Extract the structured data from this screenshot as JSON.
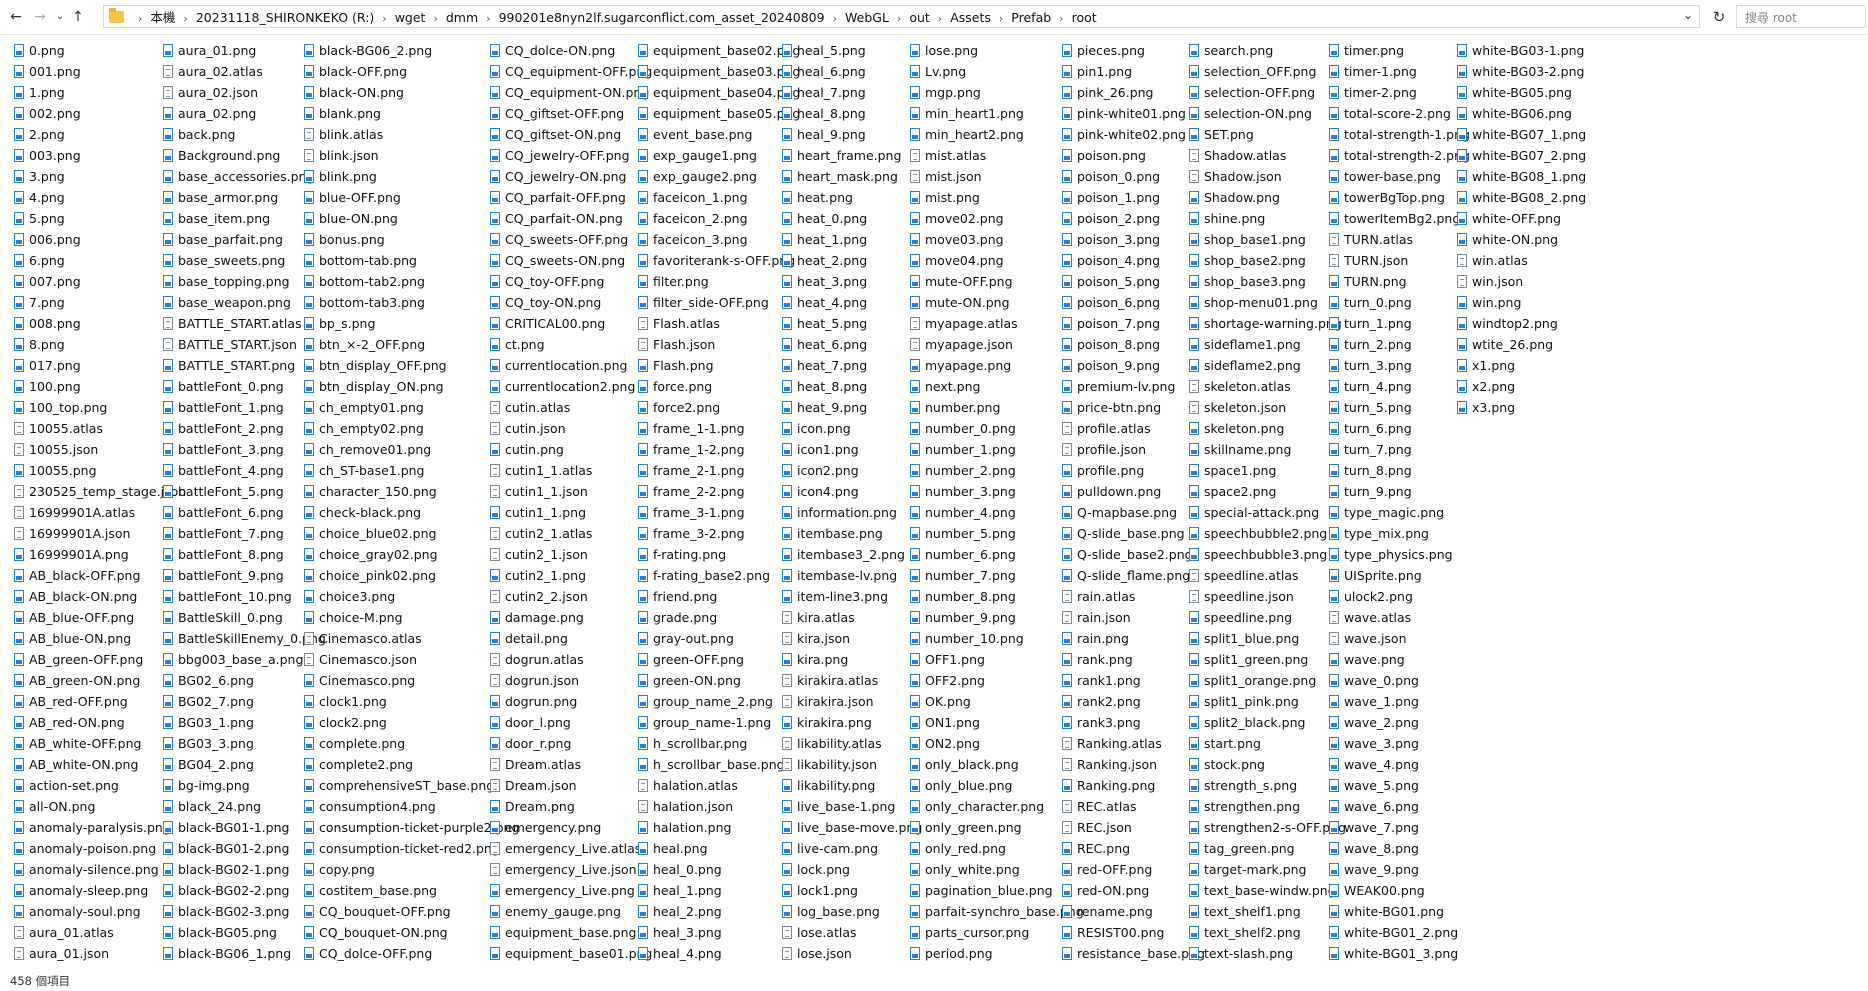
{
  "nav": {
    "back_icon": "arrow-left-icon",
    "forward_icon": "arrow-right-icon",
    "recent_icon": "chevron-down-icon",
    "up_icon": "arrow-up-icon"
  },
  "address": {
    "crumbs": [
      "本機",
      "20231118_SHIRONKEKO (R:)",
      "wget",
      "dmm",
      "990201e8nyn2lf.sugarconflict.com_asset_20240809",
      "WebGL",
      "out",
      "Assets",
      "Prefab",
      "root"
    ]
  },
  "search": {
    "placeholder": "搜尋 root"
  },
  "status": {
    "item_count": "458 個項目"
  },
  "files": [
    [
      "0.png",
      "001.png",
      "1.png",
      "002.png",
      "2.png",
      "003.png",
      "3.png",
      "4.png",
      "5.png",
      "006.png",
      "6.png",
      "007.png",
      "7.png",
      "008.png",
      "8.png",
      "017.png",
      "100.png",
      "100_top.png",
      "10055.atlas",
      "10055.json",
      "10055.png",
      "230525_temp_stage.json",
      "16999901A.atlas",
      "16999901A.json",
      "16999901A.png",
      "AB_black-OFF.png",
      "AB_black-ON.png",
      "AB_blue-OFF.png",
      "AB_blue-ON.png",
      "AB_green-OFF.png",
      "AB_green-ON.png",
      "AB_red-OFF.png",
      "AB_red-ON.png",
      "AB_white-OFF.png",
      "AB_white-ON.png",
      "action-set.png",
      "all-ON.png",
      "anomaly-paralysis.png",
      "anomaly-poison.png",
      "anomaly-silence.png",
      "anomaly-sleep.png",
      "anomaly-soul.png",
      "aura_01.atlas",
      "aura_01.json"
    ],
    [
      "aura_01.png",
      "aura_02.atlas",
      "aura_02.json",
      "aura_02.png",
      "back.png",
      "Background.png",
      "base_accessories.png",
      "base_armor.png",
      "base_item.png",
      "base_parfait.png",
      "base_sweets.png",
      "base_topping.png",
      "base_weapon.png",
      "BATTLE_START.atlas",
      "BATTLE_START.json",
      "BATTLE_START.png",
      "battleFont_0.png",
      "battleFont_1.png",
      "battleFont_2.png",
      "battleFont_3.png",
      "battleFont_4.png",
      "battleFont_5.png",
      "battleFont_6.png",
      "battleFont_7.png",
      "battleFont_8.png",
      "battleFont_9.png",
      "battleFont_10.png",
      "BattleSkill_0.png",
      "BattleSkillEnemy_0.png",
      "bbg003_base_a.png",
      "BG02_6.png",
      "BG02_7.png",
      "BG03_1.png",
      "BG03_3.png",
      "BG04_2.png",
      "bg-img.png",
      "black_24.png",
      "black-BG01-1.png",
      "black-BG01-2.png",
      "black-BG02-1.png",
      "black-BG02-2.png",
      "black-BG02-3.png",
      "black-BG05.png",
      "black-BG06_1.png"
    ],
    [
      "black-BG06_2.png",
      "black-OFF.png",
      "black-ON.png",
      "blank.png",
      "blink.atlas",
      "blink.json",
      "blink.png",
      "blue-OFF.png",
      "blue-ON.png",
      "bonus.png",
      "bottom-tab.png",
      "bottom-tab2.png",
      "bottom-tab3.png",
      "bp_s.png",
      "btn_×-2_OFF.png",
      "btn_display_OFF.png",
      "btn_display_ON.png",
      "ch_empty01.png",
      "ch_empty02.png",
      "ch_remove01.png",
      "ch_ST-base1.png",
      "character_150.png",
      "check-black.png",
      "choice_blue02.png",
      "choice_gray02.png",
      "choice_pink02.png",
      "choice3.png",
      "choice-M.png",
      "Cinemasco.atlas",
      "Cinemasco.json",
      "Cinemasco.png",
      "clock1.png",
      "clock2.png",
      "complete.png",
      "complete2.png",
      "comprehensiveST_base.png",
      "consumption4.png",
      "consumption-ticket-purple2.png",
      "consumption-ticket-red2.png",
      "copy.png",
      "costitem_base.png",
      "CQ_bouquet-OFF.png",
      "CQ_bouquet-ON.png",
      "CQ_dolce-OFF.png"
    ],
    [
      "CQ_dolce-ON.png",
      "CQ_equipment-OFF.png",
      "CQ_equipment-ON.png",
      "CQ_giftset-OFF.png",
      "CQ_giftset-ON.png",
      "CQ_jewelry-OFF.png",
      "CQ_jewelry-ON.png",
      "CQ_parfait-OFF.png",
      "CQ_parfait-ON.png",
      "CQ_sweets-OFF.png",
      "CQ_sweets-ON.png",
      "CQ_toy-OFF.png",
      "CQ_toy-ON.png",
      "CRITICAL00.png",
      "ct.png",
      "currentlocation.png",
      "currentlocation2.png",
      "cutin.atlas",
      "cutin.json",
      "cutin.png",
      "cutin1_1.atlas",
      "cutin1_1.json",
      "cutin1_1.png",
      "cutin2_1.atlas",
      "cutin2_1.json",
      "cutin2_1.png",
      "cutin2_2.json",
      "damage.png",
      "detail.png",
      "dogrun.atlas",
      "dogrun.json",
      "dogrun.png",
      "door_l.png",
      "door_r.png",
      "Dream.atlas",
      "Dream.json",
      "Dream.png",
      "emergency.png",
      "emergency_Live.atlas",
      "emergency_Live.json",
      "emergency_Live.png",
      "enemy_gauge.png",
      "equipment_base.png",
      "equipment_base01.png"
    ],
    [
      "equipment_base02.png",
      "equipment_base03.png",
      "equipment_base04.png",
      "equipment_base05.png",
      "event_base.png",
      "exp_gauge1.png",
      "exp_gauge2.png",
      "faceicon_1.png",
      "faceicon_2.png",
      "faceicon_3.png",
      "favoriterank-s-OFF.png",
      "filter.png",
      "filter_side-OFF.png",
      "Flash.atlas",
      "Flash.json",
      "Flash.png",
      "force.png",
      "force2.png",
      "frame_1-1.png",
      "frame_1-2.png",
      "frame_2-1.png",
      "frame_2-2.png",
      "frame_3-1.png",
      "frame_3-2.png",
      "f-rating.png",
      "f-rating_base2.png",
      "friend.png",
      "grade.png",
      "gray-out.png",
      "green-OFF.png",
      "green-ON.png",
      "group_name_2.png",
      "group_name-1.png",
      "h_scrollbar.png",
      "h_scrollbar_base.png",
      "halation.atlas",
      "halation.json",
      "halation.png",
      "heal.png",
      "heal_0.png",
      "heal_1.png",
      "heal_2.png",
      "heal_3.png",
      "heal_4.png"
    ],
    [
      "heal_5.png",
      "heal_6.png",
      "heal_7.png",
      "heal_8.png",
      "heal_9.png",
      "heart_frame.png",
      "heart_mask.png",
      "heat.png",
      "heat_0.png",
      "heat_1.png",
      "heat_2.png",
      "heat_3.png",
      "heat_4.png",
      "heat_5.png",
      "heat_6.png",
      "heat_7.png",
      "heat_8.png",
      "heat_9.png",
      "icon.png",
      "icon1.png",
      "icon2.png",
      "icon4.png",
      "information.png",
      "itembase.png",
      "itembase3_2.png",
      "itembase-lv.png",
      "item-line3.png",
      "kira.atlas",
      "kira.json",
      "kira.png",
      "kirakira.atlas",
      "kirakira.json",
      "kirakira.png",
      "likability.atlas",
      "likability.json",
      "likability.png",
      "live_base-1.png",
      "live_base-move.png",
      "live-cam.png",
      "lock.png",
      "lock1.png",
      "log_base.png",
      "lose.atlas",
      "lose.json"
    ],
    [
      "lose.png",
      "Lv.png",
      "mgp.png",
      "min_heart1.png",
      "min_heart2.png",
      "mist.atlas",
      "mist.json",
      "mist.png",
      "move02.png",
      "move03.png",
      "move04.png",
      "mute-OFF.png",
      "mute-ON.png",
      "myapage.atlas",
      "myapage.json",
      "myapage.png",
      "next.png",
      "number.png",
      "number_0.png",
      "number_1.png",
      "number_2.png",
      "number_3.png",
      "number_4.png",
      "number_5.png",
      "number_6.png",
      "number_7.png",
      "number_8.png",
      "number_9.png",
      "number_10.png",
      "OFF1.png",
      "OFF2.png",
      "OK.png",
      "ON1.png",
      "ON2.png",
      "only_black.png",
      "only_blue.png",
      "only_character.png",
      "only_green.png",
      "only_red.png",
      "only_white.png",
      "pagination_blue.png",
      "parfait-synchro_base.png",
      "parts_cursor.png",
      "period.png"
    ],
    [
      "pieces.png",
      "pin1.png",
      "pink_26.png",
      "pink-white01.png",
      "pink-white02.png",
      "poison.png",
      "poison_0.png",
      "poison_1.png",
      "poison_2.png",
      "poison_3.png",
      "poison_4.png",
      "poison_5.png",
      "poison_6.png",
      "poison_7.png",
      "poison_8.png",
      "poison_9.png",
      "premium-lv.png",
      "price-btn.png",
      "profile.atlas",
      "profile.json",
      "profile.png",
      "pulldown.png",
      "Q-mapbase.png",
      "Q-slide_base.png",
      "Q-slide_base2.png",
      "Q-slide_flame.png",
      "rain.atlas",
      "rain.json",
      "rain.png",
      "rank.png",
      "rank1.png",
      "rank2.png",
      "rank3.png",
      "Ranking.atlas",
      "Ranking.json",
      "Ranking.png",
      "REC.atlas",
      "REC.json",
      "REC.png",
      "red-OFF.png",
      "red-ON.png",
      "rename.png",
      "RESIST00.png",
      "resistance_base.png"
    ],
    [
      "search.png",
      "selection_OFF.png",
      "selection-OFF.png",
      "selection-ON.png",
      "SET.png",
      "Shadow.atlas",
      "Shadow.json",
      "Shadow.png",
      "shine.png",
      "shop_base1.png",
      "shop_base2.png",
      "shop_base3.png",
      "shop-menu01.png",
      "shortage-warning.png",
      "sideflame1.png",
      "sideflame2.png",
      "skeleton.atlas",
      "skeleton.json",
      "skeleton.png",
      "skillname.png",
      "space1.png",
      "space2.png",
      "special-attack.png",
      "speechbubble2.png",
      "speechbubble3.png",
      "speedline.atlas",
      "speedline.json",
      "speedline.png",
      "split1_blue.png",
      "split1_green.png",
      "split1_orange.png",
      "split1_pink.png",
      "split2_black.png",
      "start.png",
      "stock.png",
      "strength_s.png",
      "strengthen.png",
      "strengthen2-s-OFF.png",
      "tag_green.png",
      "target-mark.png",
      "text_base-windw.png",
      "text_shelf1.png",
      "text_shelf2.png",
      "text-slash.png"
    ],
    [
      "timer.png",
      "timer-1.png",
      "timer-2.png",
      "total-score-2.png",
      "total-strength-1.png",
      "total-strength-2.png",
      "tower-base.png",
      "towerBgTop.png",
      "towerItemBg2.png",
      "TURN.atlas",
      "TURN.json",
      "TURN.png",
      "turn_0.png",
      "turn_1.png",
      "turn_2.png",
      "turn_3.png",
      "turn_4.png",
      "turn_5.png",
      "turn_6.png",
      "turn_7.png",
      "turn_8.png",
      "turn_9.png",
      "type_magic.png",
      "type_mix.png",
      "type_physics.png",
      "UISprite.png",
      "ulock2.png",
      "wave.atlas",
      "wave.json",
      "wave.png",
      "wave_0.png",
      "wave_1.png",
      "wave_2.png",
      "wave_3.png",
      "wave_4.png",
      "wave_5.png",
      "wave_6.png",
      "wave_7.png",
      "wave_8.png",
      "wave_9.png",
      "WEAK00.png",
      "white-BG01.png",
      "white-BG01_2.png",
      "white-BG01_3.png"
    ],
    [
      "white-BG03-1.png",
      "white-BG03-2.png",
      "white-BG05.png",
      "white-BG06.png",
      "white-BG07_1.png",
      "white-BG07_2.png",
      "white-BG08_1.png",
      "white-BG08_2.png",
      "white-OFF.png",
      "white-ON.png",
      "win.atlas",
      "win.json",
      "win.png",
      "windtop2.png",
      "wtite_26.png",
      "x1.png",
      "x2.png",
      "x3.png"
    ]
  ]
}
